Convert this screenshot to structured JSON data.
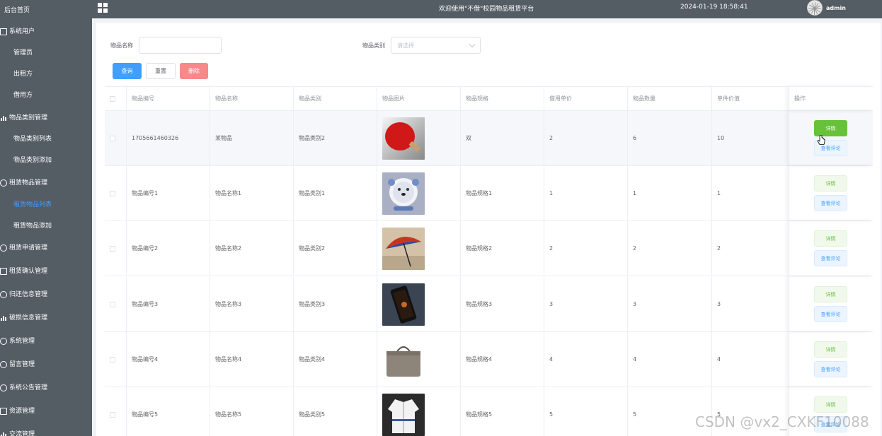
{
  "sidebar": {
    "items": [
      {
        "label": "后台首页",
        "type": "top",
        "icon": ""
      },
      {
        "label": "系统用户",
        "type": "group",
        "icon": "doc-icon"
      },
      {
        "label": "管理员",
        "type": "sub"
      },
      {
        "label": "出租方",
        "type": "sub"
      },
      {
        "label": "借用方",
        "type": "sub"
      },
      {
        "label": "物品类别管理",
        "type": "group",
        "icon": "bar-chart-icon"
      },
      {
        "label": "物品类别列表",
        "type": "sub"
      },
      {
        "label": "物品类别添加",
        "type": "sub"
      },
      {
        "label": "租赁物品管理",
        "type": "group",
        "icon": "chat-icon"
      },
      {
        "label": "租赁物品列表",
        "type": "sub",
        "active": true
      },
      {
        "label": "租赁物品添加",
        "type": "sub"
      },
      {
        "label": "租赁申请管理",
        "type": "group",
        "icon": "check-circle-icon"
      },
      {
        "label": "租赁确认管理",
        "type": "group",
        "icon": "doc-icon"
      },
      {
        "label": "归还信息管理",
        "type": "group",
        "icon": "chat-icon"
      },
      {
        "label": "破损信息管理",
        "type": "group",
        "icon": "bar-chart-icon"
      },
      {
        "label": "系统管理",
        "type": "group",
        "icon": "check-circle-icon"
      },
      {
        "label": "留言管理",
        "type": "group",
        "icon": "chat-icon"
      },
      {
        "label": "系统公告管理",
        "type": "group",
        "icon": "check-circle-icon"
      },
      {
        "label": "资源管理",
        "type": "group",
        "icon": "doc-icon"
      },
      {
        "label": "交流管理",
        "type": "group",
        "icon": "bar-chart-icon"
      }
    ]
  },
  "header": {
    "title": "欢迎使用\"不借\"校园物品租赁平台",
    "datetime": "2024-01-19 18:58:41",
    "username": "admin"
  },
  "search": {
    "name_label": "物品名称",
    "name_value": "",
    "category_label": "物品类别",
    "category_placeholder": "请选择"
  },
  "buttons": {
    "query": "查询",
    "reset": "重置",
    "delete": "删除"
  },
  "table": {
    "columns": [
      "物品编号",
      "物品名称",
      "物品类别",
      "物品图片",
      "物品规格",
      "借用单价",
      "物品数量",
      "单件价值",
      "操作"
    ],
    "detail_label": "详情",
    "comment_label": "查看评论",
    "rows": [
      {
        "code": "1705661460326",
        "name": "某物品",
        "category": "物品类别2",
        "image": "ping-pong-paddle",
        "spec": "双",
        "price": "2",
        "qty": "6",
        "value": "10"
      },
      {
        "code": "物品编号1",
        "name": "物品名称1",
        "category": "物品类别1",
        "image": "desk-fan",
        "spec": "物品规格1",
        "price": "1",
        "qty": "1",
        "value": "1"
      },
      {
        "code": "物品编号2",
        "name": "物品名称2",
        "category": "物品类别2",
        "image": "umbrella",
        "spec": "物品规格2",
        "price": "2",
        "qty": "2",
        "value": "2"
      },
      {
        "code": "物品编号3",
        "name": "物品名称3",
        "category": "物品类别3",
        "image": "smartphone",
        "spec": "物品规格3",
        "price": "3",
        "qty": "3",
        "value": "3"
      },
      {
        "code": "物品编号4",
        "name": "物品名称4",
        "category": "物品类别4",
        "image": "handbag",
        "spec": "物品规格4",
        "price": "4",
        "qty": "4",
        "value": "4"
      },
      {
        "code": "物品编号5",
        "name": "物品名称5",
        "category": "物品类别5",
        "image": "jacket",
        "spec": "物品规格5",
        "price": "5",
        "qty": "5",
        "value": "5"
      }
    ]
  },
  "watermark": "CSDN @vx2_CXKF10088",
  "colors": {
    "sidebar_bg": "#545c64",
    "primary": "#409EFF",
    "success": "#67c23a",
    "danger": "#f78989"
  }
}
